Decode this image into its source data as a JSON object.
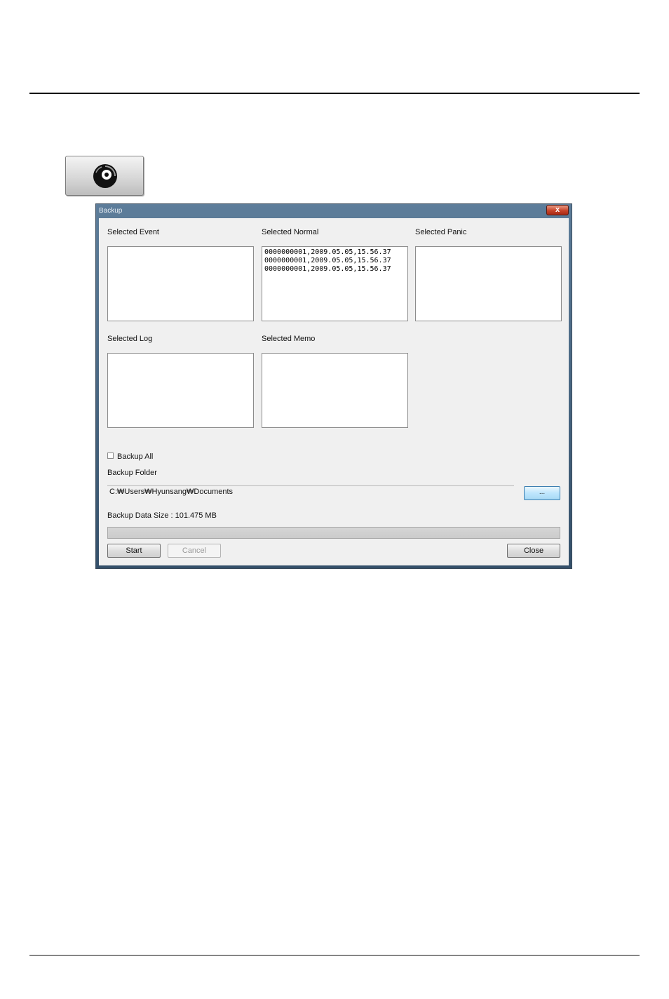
{
  "dialog": {
    "title": "Backup",
    "close_glyph": "x",
    "lists": {
      "event": {
        "label": "Selected Event",
        "items": []
      },
      "normal": {
        "label": "Selected Normal",
        "items": [
          "0000000001,2009.05.05,15.56.37",
          "0000000001,2009.05.05,15.56.37",
          "0000000001,2009.05.05,15.56.37"
        ]
      },
      "panic": {
        "label": "Selected Panic",
        "items": []
      },
      "log": {
        "label": "Selected Log",
        "items": []
      },
      "memo": {
        "label": "Selected Memo",
        "items": []
      }
    },
    "backup_all": {
      "label": "Backup All",
      "checked": false
    },
    "backup_folder": {
      "label": "Backup Folder",
      "path": "C:₩Users₩Hyunsang₩Documents",
      "browse_label": "..."
    },
    "data_size": "Backup Data Size : 101.475 MB",
    "progress": 0,
    "buttons": {
      "start": "Start",
      "cancel": "Cancel",
      "close": "Close"
    }
  },
  "icons": {
    "backup_button_icon": "disc-icon",
    "close_icon": "close-icon"
  },
  "colors": {
    "browse_button_accent": "#bee6fd",
    "title_close": "#c8442a"
  }
}
